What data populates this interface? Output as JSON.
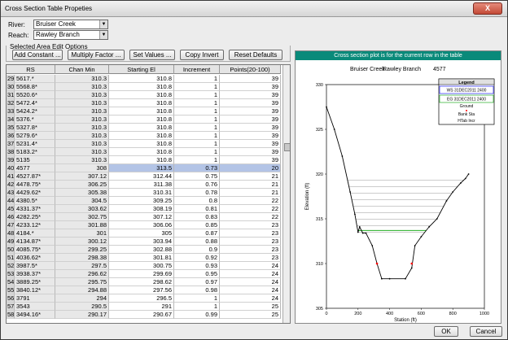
{
  "window": {
    "title": "Cross Section Table Propeties",
    "close_glyph": "X"
  },
  "river": {
    "label": "River:",
    "value": "Bruiser Creek"
  },
  "reach": {
    "label": "Reach:",
    "value": "Rawley Branch"
  },
  "options": {
    "label": "Selected Area Edit Options",
    "buttons": [
      "Add Constant ...",
      "Multiply Factor ...",
      "Set Values ...",
      "Copy Invert",
      "Reset Defaults"
    ]
  },
  "table": {
    "headers": [
      "RS",
      "Chan Min",
      "Starting El",
      "Increment",
      "Points(20-100)"
    ],
    "selected_row_number": "40",
    "rows": [
      [
        "29",
        "5617.*",
        "310.3",
        "310.8",
        "1",
        "39"
      ],
      [
        "30",
        "5568.8*",
        "310.3",
        "310.8",
        "1",
        "39"
      ],
      [
        "31",
        "5520.6*",
        "310.3",
        "310.8",
        "1",
        "39"
      ],
      [
        "32",
        "5472.4*",
        "310.3",
        "310.8",
        "1",
        "39"
      ],
      [
        "33",
        "5424.2*",
        "310.3",
        "310.8",
        "1",
        "39"
      ],
      [
        "34",
        "5376.*",
        "310.3",
        "310.8",
        "1",
        "39"
      ],
      [
        "35",
        "5327.8*",
        "310.3",
        "310.8",
        "1",
        "39"
      ],
      [
        "36",
        "5279.6*",
        "310.3",
        "310.8",
        "1",
        "39"
      ],
      [
        "37",
        "5231.4*",
        "310.3",
        "310.8",
        "1",
        "39"
      ],
      [
        "38",
        "5183.2*",
        "310.3",
        "310.8",
        "1",
        "39"
      ],
      [
        "39",
        "5135",
        "310.3",
        "310.8",
        "1",
        "39"
      ],
      [
        "40",
        "4577",
        "308",
        "313.5",
        "0.73",
        "20"
      ],
      [
        "41",
        "4527.87*",
        "307.12",
        "312.44",
        "0.75",
        "21"
      ],
      [
        "42",
        "4478.75*",
        "306.25",
        "311.38",
        "0.76",
        "21"
      ],
      [
        "43",
        "4429.62*",
        "305.38",
        "310.31",
        "0.78",
        "21"
      ],
      [
        "44",
        "4380.5*",
        "304.5",
        "309.25",
        "0.8",
        "22"
      ],
      [
        "45",
        "4331.37*",
        "303.62",
        "308.19",
        "0.81",
        "22"
      ],
      [
        "46",
        "4282.25*",
        "302.75",
        "307.12",
        "0.83",
        "22"
      ],
      [
        "47",
        "4233.12*",
        "301.88",
        "306.06",
        "0.85",
        "23"
      ],
      [
        "48",
        "4184.*",
        "301",
        "305",
        "0.87",
        "23"
      ],
      [
        "49",
        "4134.87*",
        "300.12",
        "303.94",
        "0.88",
        "23"
      ],
      [
        "50",
        "4085.75*",
        "299.25",
        "302.88",
        "0.9",
        "23"
      ],
      [
        "51",
        "4036.62*",
        "298.38",
        "301.81",
        "0.92",
        "23"
      ],
      [
        "52",
        "3987.5*",
        "297.5",
        "300.75",
        "0.93",
        "24"
      ],
      [
        "53",
        "3938.37*",
        "296.62",
        "299.69",
        "0.95",
        "24"
      ],
      [
        "54",
        "3889.25*",
        "295.75",
        "298.62",
        "0.97",
        "24"
      ],
      [
        "55",
        "3840.12*",
        "294.88",
        "297.56",
        "0.98",
        "24"
      ],
      [
        "56",
        "3791",
        "294",
        "296.5",
        "1",
        "24"
      ],
      [
        "57",
        "3543",
        "290.5",
        "291",
        "1",
        "25"
      ],
      [
        "58",
        "3494.16*",
        "290.17",
        "290.67",
        "0.99",
        "25"
      ]
    ]
  },
  "plot": {
    "header": "Cross section plot is for the current row in the table",
    "title_river": "Bruiser Creek",
    "title_reach": "Rawley Branch",
    "title_rs": "4577",
    "legend_title": "Legend",
    "legend_ws": "WS 31DEC2011 2400",
    "legend_eg": "EG 31DEC2011 2400",
    "legend_ground": "Ground",
    "legend_bank": "Bank Sta",
    "legend_htab": "HTab Incr",
    "colors": {
      "ws": "#0000ff",
      "eg": "#00a000",
      "ground": "#000000",
      "bank": "#ff0000",
      "htab": "#808080",
      "header_bg": "#0a8a7a"
    }
  },
  "chart_data": {
    "type": "line",
    "title": "Bruiser Creek    Rawley Branch    4577",
    "xlabel": "Station (ft)",
    "ylabel": "Elevation (ft)",
    "xlim": [
      0,
      1000
    ],
    "ylim": [
      305,
      330
    ],
    "xticks": [
      "0",
      "200",
      "400",
      "600",
      "800",
      "1000"
    ],
    "yticks": [
      "305",
      "310",
      "315",
      "320",
      "325",
      "330"
    ],
    "ground": {
      "x": [
        0,
        50,
        100,
        150,
        180,
        200,
        210,
        230,
        250,
        290,
        320,
        350,
        400,
        500,
        540,
        560,
        600,
        650,
        700,
        760,
        800,
        850,
        880,
        900
      ],
      "y": [
        327.5,
        325,
        322,
        318,
        315.5,
        313.5,
        314.1,
        313.4,
        313.4,
        312,
        310,
        308.3,
        308.3,
        308.3,
        309.5,
        312,
        313,
        314.1,
        315,
        317,
        318,
        319,
        319.5,
        320
      ]
    },
    "bank_stations": [
      {
        "x": 320,
        "y": 310
      },
      {
        "x": 540,
        "y": 310
      }
    ],
    "ws_elevation": 313.7,
    "htab_start": 313.5,
    "htab_increment": 0.73,
    "htab_count": 20
  },
  "footer": {
    "ok": "OK",
    "cancel": "Cancel"
  }
}
